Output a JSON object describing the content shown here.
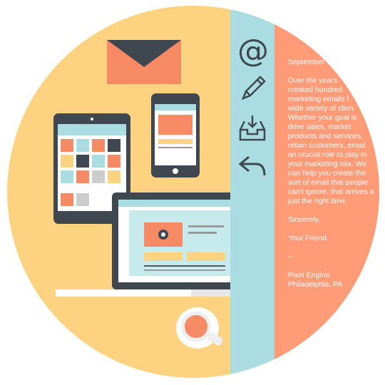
{
  "letter": {
    "date": "September",
    "body_lines": [
      "Over the years",
      "created hundred",
      "marketing emails f",
      "wide variety of clien",
      "Whether your goal is",
      "drive sales, market",
      "products and services,",
      "retain customers, email",
      "an crucial role to play in",
      "your marketing mix. We",
      "can help you create the",
      "sort of email that people",
      "can't ignore, that arrives a",
      "just the right time."
    ],
    "closing": "Sincerely,",
    "signature": "Your Friend",
    "separator": "--",
    "company": "Pixel Engine",
    "location": "Philadelphia, PA"
  },
  "toolbar_icons": [
    "at-sign-icon",
    "pencil-icon",
    "inbox-download-icon",
    "reply-icon"
  ],
  "colors": {
    "background": "#FDD382",
    "strip": "#AADDE1",
    "panel": "#FF9B77",
    "device": "#3F4750",
    "envelope": "#F58A64"
  }
}
